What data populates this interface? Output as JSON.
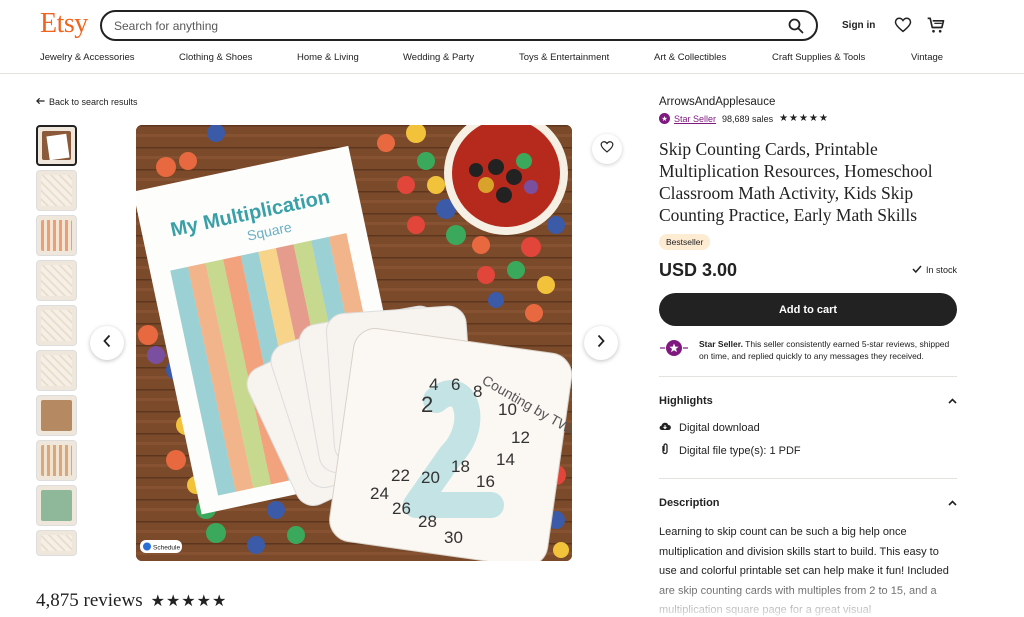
{
  "header": {
    "logo": "Etsy",
    "search_placeholder": "Search for anything",
    "sign_in": "Sign in"
  },
  "nav": {
    "items": [
      "Jewelry & Accessories",
      "Clothing & Shoes",
      "Home & Living",
      "Wedding & Party",
      "Toys & Entertainment",
      "Art & Collectibles",
      "Craft Supplies & Tools",
      "Vintage"
    ]
  },
  "back_link": "Back to search results",
  "thumbnails_count": 10,
  "image": {
    "sheet_title": "My Multiplication Square",
    "card_title": "Counting by TWOS",
    "card_numbers": [
      "2",
      "4",
      "6",
      "8",
      "10",
      "12",
      "14",
      "16",
      "18",
      "20",
      "22",
      "24",
      "26",
      "28",
      "30"
    ],
    "schedule_badge": "Schedule"
  },
  "reviews": {
    "count": "4,875 reviews",
    "stars": "★★★★★"
  },
  "listing": {
    "shop_name": "ArrowsAndApplesauce",
    "star_seller": "Star Seller",
    "sales": "98,689 sales",
    "shop_stars": "★★★★★",
    "title": "Skip Counting Cards, Printable Multiplication Resources, Homeschool Classroom Math Activity, Kids Skip Counting Practice, Early Math Skills",
    "bestseller": "Bestseller",
    "price": "USD 3.00",
    "stock": "In stock",
    "add_to_cart": "Add to cart",
    "star_note_bold": "Star Seller.",
    "star_note": " This seller consistently earned 5-star reviews, shipped on time, and replied quickly to any messages they received."
  },
  "highlights": {
    "heading": "Highlights",
    "items": [
      "Digital download",
      "Digital file type(s): 1 PDF"
    ]
  },
  "description": {
    "heading": "Description",
    "text": "Learning to skip count can be such a big help once multiplication and division skills start to build. This easy to use and colorful printable set can help make it fun! Included are skip counting cards with multiples from 2 to 15, and a multiplication square page for a great visual"
  },
  "colors": {
    "brand": "#f1641e",
    "star_seller": "#7f187f",
    "bestseller_bg": "#fdebd2",
    "button": "#222222"
  }
}
